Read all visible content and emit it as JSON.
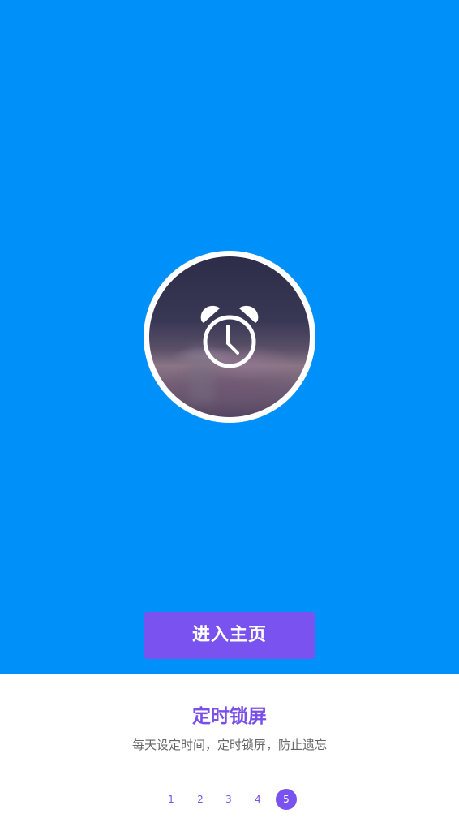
{
  "hero": {
    "background_color": "#0090fa",
    "icon": "alarm-clock-icon"
  },
  "button": {
    "label": "进入主页",
    "color": "#7a52ef"
  },
  "feature": {
    "title": "定时锁屏",
    "description": "每天设定时间，定时锁屏，防止遗忘",
    "title_color": "#7a4fe8"
  },
  "pager": {
    "pages": [
      "1",
      "2",
      "3",
      "4",
      "5"
    ],
    "active_page": "5"
  }
}
